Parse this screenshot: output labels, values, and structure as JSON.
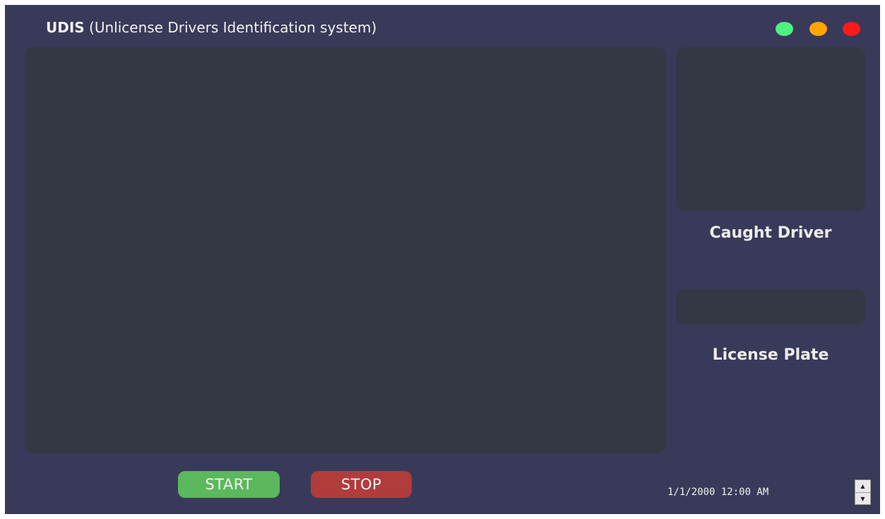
{
  "app": {
    "title_bold": "UDIS",
    "title_rest": " (Unlicense Drivers Identification system)"
  },
  "window_controls": [
    {
      "name": "green-dot-button",
      "color": "#4ef27f"
    },
    {
      "name": "orange-dot-button",
      "color": "#ffa500"
    },
    {
      "name": "red-dot-button",
      "color": "#ff1a1a"
    }
  ],
  "panels": {
    "caught_driver_label": "Caught Driver",
    "license_plate_label": "License Plate"
  },
  "buttons": {
    "start_label": "START",
    "start_color": "#5cb85c",
    "stop_label": "STOP",
    "stop_color": "#b03c3c"
  },
  "status": {
    "datetime": "1/1/2000 12:00 AM"
  }
}
